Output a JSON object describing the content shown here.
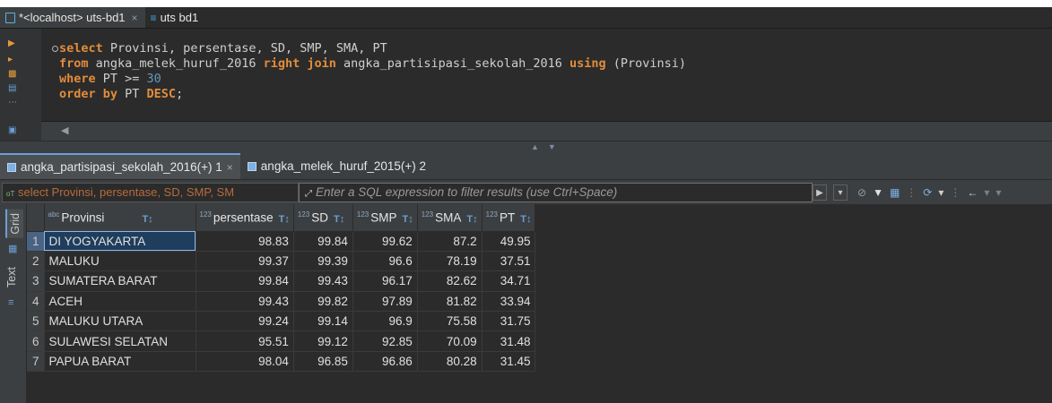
{
  "editor_tabs": [
    {
      "label": "*<localhost> uts-bd1",
      "close": "×"
    },
    {
      "label": "uts bd1"
    }
  ],
  "sql": {
    "line1": {
      "kw": "select",
      "rest": " Provinsi, persentase, SD, SMP, SMA, PT"
    },
    "line2": {
      "kw1": "from",
      "mid1": " angka_melek_huruf_2016 ",
      "kw2": "right join",
      "mid2": " angka_partisipasi_sekolah_2016 ",
      "kw3": "using",
      "rest": " (Provinsi)"
    },
    "line3": {
      "kw": "where",
      "mid": " PT >= ",
      "num": "30"
    },
    "line4": {
      "kw1": "order by",
      "mid": " PT ",
      "kw2": "DESC",
      "end": ";"
    }
  },
  "result_tabs": [
    {
      "label": "angka_partisipasi_sekolah_2016(+) 1",
      "close": "×"
    },
    {
      "label": "angka_melek_huruf_2015(+) 2"
    }
  ],
  "filter": {
    "sql_preview": "select Provinsi, persentase, SD, SMP, SM",
    "placeholder": "Enter a SQL expression to filter results (use Ctrl+Space)"
  },
  "side_tabs": {
    "grid": "Grid",
    "text": "Text"
  },
  "grid": {
    "type_badge_text": "abc",
    "type_badge_num": "123",
    "columns": [
      "Provinsi",
      "persentase",
      "SD",
      "SMP",
      "SMA",
      "PT"
    ],
    "rows": [
      {
        "n": "1",
        "Provinsi": "DI YOGYAKARTA",
        "persentase": "98.83",
        "SD": "99.84",
        "SMP": "99.62",
        "SMA": "87.2",
        "PT": "49.95"
      },
      {
        "n": "2",
        "Provinsi": "MALUKU",
        "persentase": "99.37",
        "SD": "99.39",
        "SMP": "96.6",
        "SMA": "78.19",
        "PT": "37.51"
      },
      {
        "n": "3",
        "Provinsi": "SUMATERA BARAT",
        "persentase": "99.84",
        "SD": "99.43",
        "SMP": "96.17",
        "SMA": "82.62",
        "PT": "34.71"
      },
      {
        "n": "4",
        "Provinsi": "ACEH",
        "persentase": "99.43",
        "SD": "99.82",
        "SMP": "97.89",
        "SMA": "81.82",
        "PT": "33.94"
      },
      {
        "n": "5",
        "Provinsi": "MALUKU UTARA",
        "persentase": "99.24",
        "SD": "99.14",
        "SMP": "96.9",
        "SMA": "75.58",
        "PT": "31.75"
      },
      {
        "n": "6",
        "Provinsi": "SULAWESI SELATAN",
        "persentase": "95.51",
        "SD": "99.12",
        "SMP": "92.85",
        "SMA": "70.09",
        "PT": "31.48"
      },
      {
        "n": "7",
        "Provinsi": "PAPUA BARAT",
        "persentase": "98.04",
        "SD": "96.85",
        "SMP": "96.86",
        "SMA": "80.28",
        "PT": "31.45"
      }
    ]
  }
}
